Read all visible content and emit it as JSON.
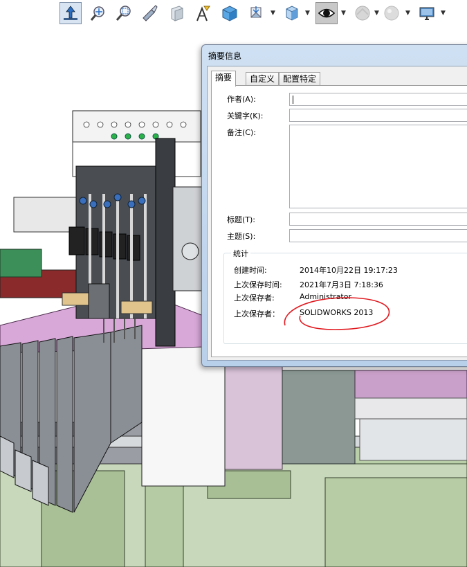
{
  "toolbar": {
    "icons": [
      "normal-to-icon",
      "zoom-to-fit-icon",
      "zoom-area-icon",
      "pan-icon",
      "section-view-icon",
      "dynamic-annotation-icon",
      "view-orientation-icon",
      "display-style-icon",
      "hide-show-icon",
      "view-setting-icon",
      "scene-icon",
      "display-monitor-icon"
    ]
  },
  "dialog": {
    "title": "摘要信息",
    "tabs": [
      "摘要",
      "自定义",
      "配置特定"
    ],
    "fields": {
      "author_label": "作者(A):",
      "keywords_label": "关键字(K):",
      "comments_label": "备注(C):",
      "title_label": "标题(T):",
      "subject_label": "主题(S):",
      "author_value": "",
      "keywords_value": "",
      "comments_value": "",
      "title_value": "",
      "subject_value": ""
    },
    "stats": {
      "legend": "统计",
      "created_label": "创建时间:",
      "created_value": "2014年10月22日 19:17:23",
      "last_saved_label": "上次保存时间:",
      "last_saved_value": "2021年7月3日 7:18:36",
      "saved_by_label": "上次保存者:",
      "saved_by_value": "Administrator",
      "saved_by_app_label": "上次保存者：",
      "saved_by_app_value": "SOLIDWORKS 2013"
    },
    "annotation_color": "#e0191f"
  }
}
